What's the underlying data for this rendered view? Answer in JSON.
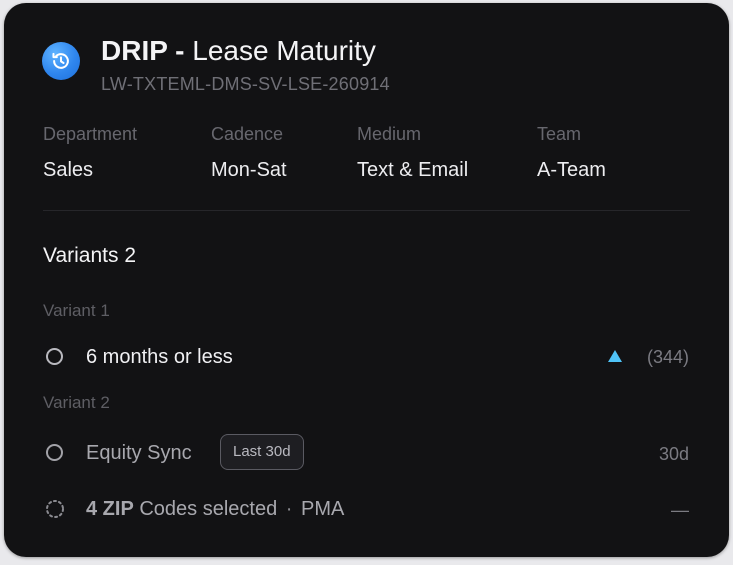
{
  "header": {
    "brand": "DRIP -",
    "title": "Lease Maturity",
    "code": "LW-TXTEML-DMS-SV-LSE-260914",
    "logo_icon": "history-clock-icon"
  },
  "meta": {
    "department_label": "Department",
    "department_value": "Sales",
    "cadence_label": "Cadence",
    "cadence_value": "Mon-Sat",
    "medium_label": "Medium",
    "medium_value": "Text & Email",
    "team_label": "Team",
    "team_value": "A-Team"
  },
  "variants": {
    "heading": "Variants 2",
    "items": [
      {
        "label": "Variant 1",
        "option": "6 months or less",
        "trend_icon": "triangle-up-icon",
        "count": "(344)"
      },
      {
        "label": "Variant 2",
        "option": "Equity Sync",
        "badge": "Last 30d",
        "duration": "30d"
      }
    ],
    "zip_row": {
      "strong": "4 ZIP",
      "text": "Codes selected",
      "separator": "·",
      "extra": "PMA",
      "empty": "—"
    }
  },
  "colors": {
    "card_bg": "#121214",
    "accent_blue": "#2f86ee",
    "trend_cyan": "#4fc3f7"
  }
}
